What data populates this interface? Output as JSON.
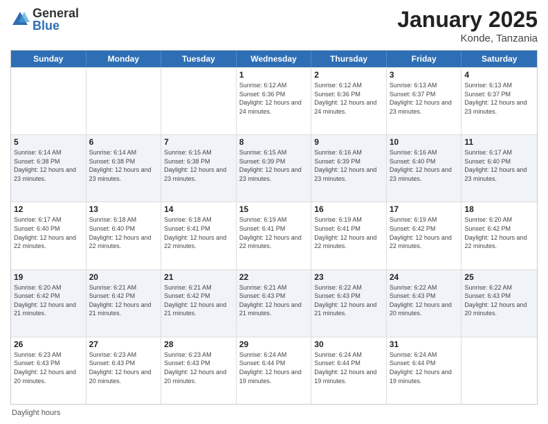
{
  "logo": {
    "general": "General",
    "blue": "Blue"
  },
  "title": {
    "month": "January 2025",
    "location": "Konde, Tanzania"
  },
  "header_days": [
    "Sunday",
    "Monday",
    "Tuesday",
    "Wednesday",
    "Thursday",
    "Friday",
    "Saturday"
  ],
  "footer": "Daylight hours",
  "weeks": [
    [
      {
        "day": "",
        "sunrise": "",
        "sunset": "",
        "daylight": ""
      },
      {
        "day": "",
        "sunrise": "",
        "sunset": "",
        "daylight": ""
      },
      {
        "day": "",
        "sunrise": "",
        "sunset": "",
        "daylight": ""
      },
      {
        "day": "1",
        "sunrise": "Sunrise: 6:12 AM",
        "sunset": "Sunset: 6:36 PM",
        "daylight": "Daylight: 12 hours and 24 minutes."
      },
      {
        "day": "2",
        "sunrise": "Sunrise: 6:12 AM",
        "sunset": "Sunset: 6:36 PM",
        "daylight": "Daylight: 12 hours and 24 minutes."
      },
      {
        "day": "3",
        "sunrise": "Sunrise: 6:13 AM",
        "sunset": "Sunset: 6:37 PM",
        "daylight": "Daylight: 12 hours and 23 minutes."
      },
      {
        "day": "4",
        "sunrise": "Sunrise: 6:13 AM",
        "sunset": "Sunset: 6:37 PM",
        "daylight": "Daylight: 12 hours and 23 minutes."
      }
    ],
    [
      {
        "day": "5",
        "sunrise": "Sunrise: 6:14 AM",
        "sunset": "Sunset: 6:38 PM",
        "daylight": "Daylight: 12 hours and 23 minutes."
      },
      {
        "day": "6",
        "sunrise": "Sunrise: 6:14 AM",
        "sunset": "Sunset: 6:38 PM",
        "daylight": "Daylight: 12 hours and 23 minutes."
      },
      {
        "day": "7",
        "sunrise": "Sunrise: 6:15 AM",
        "sunset": "Sunset: 6:38 PM",
        "daylight": "Daylight: 12 hours and 23 minutes."
      },
      {
        "day": "8",
        "sunrise": "Sunrise: 6:15 AM",
        "sunset": "Sunset: 6:39 PM",
        "daylight": "Daylight: 12 hours and 23 minutes."
      },
      {
        "day": "9",
        "sunrise": "Sunrise: 6:16 AM",
        "sunset": "Sunset: 6:39 PM",
        "daylight": "Daylight: 12 hours and 23 minutes."
      },
      {
        "day": "10",
        "sunrise": "Sunrise: 6:16 AM",
        "sunset": "Sunset: 6:40 PM",
        "daylight": "Daylight: 12 hours and 23 minutes."
      },
      {
        "day": "11",
        "sunrise": "Sunrise: 6:17 AM",
        "sunset": "Sunset: 6:40 PM",
        "daylight": "Daylight: 12 hours and 23 minutes."
      }
    ],
    [
      {
        "day": "12",
        "sunrise": "Sunrise: 6:17 AM",
        "sunset": "Sunset: 6:40 PM",
        "daylight": "Daylight: 12 hours and 22 minutes."
      },
      {
        "day": "13",
        "sunrise": "Sunrise: 6:18 AM",
        "sunset": "Sunset: 6:40 PM",
        "daylight": "Daylight: 12 hours and 22 minutes."
      },
      {
        "day": "14",
        "sunrise": "Sunrise: 6:18 AM",
        "sunset": "Sunset: 6:41 PM",
        "daylight": "Daylight: 12 hours and 22 minutes."
      },
      {
        "day": "15",
        "sunrise": "Sunrise: 6:19 AM",
        "sunset": "Sunset: 6:41 PM",
        "daylight": "Daylight: 12 hours and 22 minutes."
      },
      {
        "day": "16",
        "sunrise": "Sunrise: 6:19 AM",
        "sunset": "Sunset: 6:41 PM",
        "daylight": "Daylight: 12 hours and 22 minutes."
      },
      {
        "day": "17",
        "sunrise": "Sunrise: 6:19 AM",
        "sunset": "Sunset: 6:42 PM",
        "daylight": "Daylight: 12 hours and 22 minutes."
      },
      {
        "day": "18",
        "sunrise": "Sunrise: 6:20 AM",
        "sunset": "Sunset: 6:42 PM",
        "daylight": "Daylight: 12 hours and 22 minutes."
      }
    ],
    [
      {
        "day": "19",
        "sunrise": "Sunrise: 6:20 AM",
        "sunset": "Sunset: 6:42 PM",
        "daylight": "Daylight: 12 hours and 21 minutes."
      },
      {
        "day": "20",
        "sunrise": "Sunrise: 6:21 AM",
        "sunset": "Sunset: 6:42 PM",
        "daylight": "Daylight: 12 hours and 21 minutes."
      },
      {
        "day": "21",
        "sunrise": "Sunrise: 6:21 AM",
        "sunset": "Sunset: 6:42 PM",
        "daylight": "Daylight: 12 hours and 21 minutes."
      },
      {
        "day": "22",
        "sunrise": "Sunrise: 6:21 AM",
        "sunset": "Sunset: 6:43 PM",
        "daylight": "Daylight: 12 hours and 21 minutes."
      },
      {
        "day": "23",
        "sunrise": "Sunrise: 6:22 AM",
        "sunset": "Sunset: 6:43 PM",
        "daylight": "Daylight: 12 hours and 21 minutes."
      },
      {
        "day": "24",
        "sunrise": "Sunrise: 6:22 AM",
        "sunset": "Sunset: 6:43 PM",
        "daylight": "Daylight: 12 hours and 20 minutes."
      },
      {
        "day": "25",
        "sunrise": "Sunrise: 6:22 AM",
        "sunset": "Sunset: 6:43 PM",
        "daylight": "Daylight: 12 hours and 20 minutes."
      }
    ],
    [
      {
        "day": "26",
        "sunrise": "Sunrise: 6:23 AM",
        "sunset": "Sunset: 6:43 PM",
        "daylight": "Daylight: 12 hours and 20 minutes."
      },
      {
        "day": "27",
        "sunrise": "Sunrise: 6:23 AM",
        "sunset": "Sunset: 6:43 PM",
        "daylight": "Daylight: 12 hours and 20 minutes."
      },
      {
        "day": "28",
        "sunrise": "Sunrise: 6:23 AM",
        "sunset": "Sunset: 6:43 PM",
        "daylight": "Daylight: 12 hours and 20 minutes."
      },
      {
        "day": "29",
        "sunrise": "Sunrise: 6:24 AM",
        "sunset": "Sunset: 6:44 PM",
        "daylight": "Daylight: 12 hours and 19 minutes."
      },
      {
        "day": "30",
        "sunrise": "Sunrise: 6:24 AM",
        "sunset": "Sunset: 6:44 PM",
        "daylight": "Daylight: 12 hours and 19 minutes."
      },
      {
        "day": "31",
        "sunrise": "Sunrise: 6:24 AM",
        "sunset": "Sunset: 6:44 PM",
        "daylight": "Daylight: 12 hours and 19 minutes."
      },
      {
        "day": "",
        "sunrise": "",
        "sunset": "",
        "daylight": ""
      }
    ]
  ]
}
